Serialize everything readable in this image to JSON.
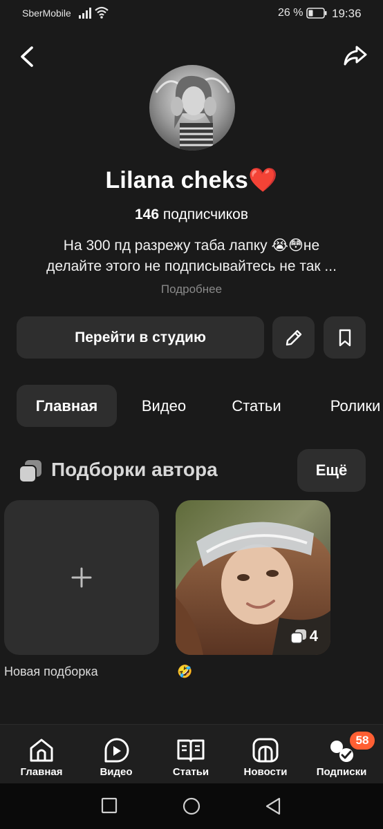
{
  "status_bar": {
    "carrier": "SberMobile",
    "battery_percent": "26 %",
    "time": "19:36"
  },
  "profile": {
    "name": "Lilana cheks❤️",
    "subscribers_count": "146",
    "subscribers_label": "подписчиков",
    "bio_line1": "На 300 пд разрежу таба лапку 😭😳не",
    "bio_line2": "делайте этого не подписывайтесь не так ...",
    "more_link": "Подробнее"
  },
  "actions": {
    "studio_button": "Перейти в студию"
  },
  "tabs": [
    {
      "label": "Главная",
      "active": true
    },
    {
      "label": "Видео",
      "active": false
    },
    {
      "label": "Статьи",
      "active": false
    },
    {
      "label": "Ролики",
      "active": false
    }
  ],
  "collections": {
    "title": "Подборки автора",
    "more_button": "Ещё",
    "new_collection_label": "Новая подборка",
    "items": [
      {
        "label": "🤣",
        "count": "4"
      }
    ]
  },
  "bottom_nav": [
    {
      "label": "Главная",
      "icon": "home-icon"
    },
    {
      "label": "Видео",
      "icon": "video-icon"
    },
    {
      "label": "Статьи",
      "icon": "book-icon"
    },
    {
      "label": "Новости",
      "icon": "news-icon"
    },
    {
      "label": "Подписки",
      "icon": "subscriptions-icon",
      "badge": "58"
    }
  ],
  "colors": {
    "background": "#1a1a1a",
    "surface": "#2e2e2e",
    "badge": "#ff5f33",
    "muted_text": "#8a8a8a"
  }
}
